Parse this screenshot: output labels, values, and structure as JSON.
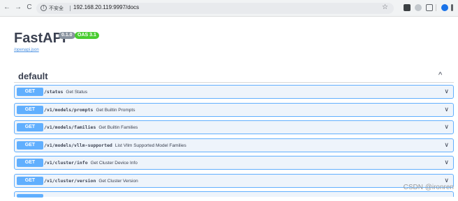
{
  "browser": {
    "security_label": "不安全",
    "url": "192.168.20.119:9997/docs",
    "back_glyph": "←",
    "forward_glyph": "→",
    "reload_glyph": "C",
    "warn_glyph": "!",
    "star_glyph": "☆"
  },
  "header": {
    "title": "FastAPI",
    "version": "0.1.0",
    "oas": "OAS 3.1",
    "openapi_link": "/openapi.json",
    "colors": {
      "version_badge": "#89939f",
      "oas_badge": "#49cc30"
    }
  },
  "section": {
    "title": "default",
    "collapse_glyph": "^"
  },
  "operations": [
    {
      "method": "GET",
      "path": "/status",
      "summary": "Get Status"
    },
    {
      "method": "GET",
      "path": "/v1/models/prompts",
      "summary": "Get Builtin Prompts"
    },
    {
      "method": "GET",
      "path": "/v1/models/families",
      "summary": "Get Builtin Families"
    },
    {
      "method": "GET",
      "path": "/v1/models/vllm-supported",
      "summary": "List Vllm Supported Model Families"
    },
    {
      "method": "GET",
      "path": "/v1/cluster/info",
      "summary": "Get Cluster Device Info"
    },
    {
      "method": "GET",
      "path": "/v1/cluster/version",
      "summary": "Get Cluster Version"
    }
  ],
  "chevron_glyph": "∨",
  "watermark": "CSDN @ironren"
}
